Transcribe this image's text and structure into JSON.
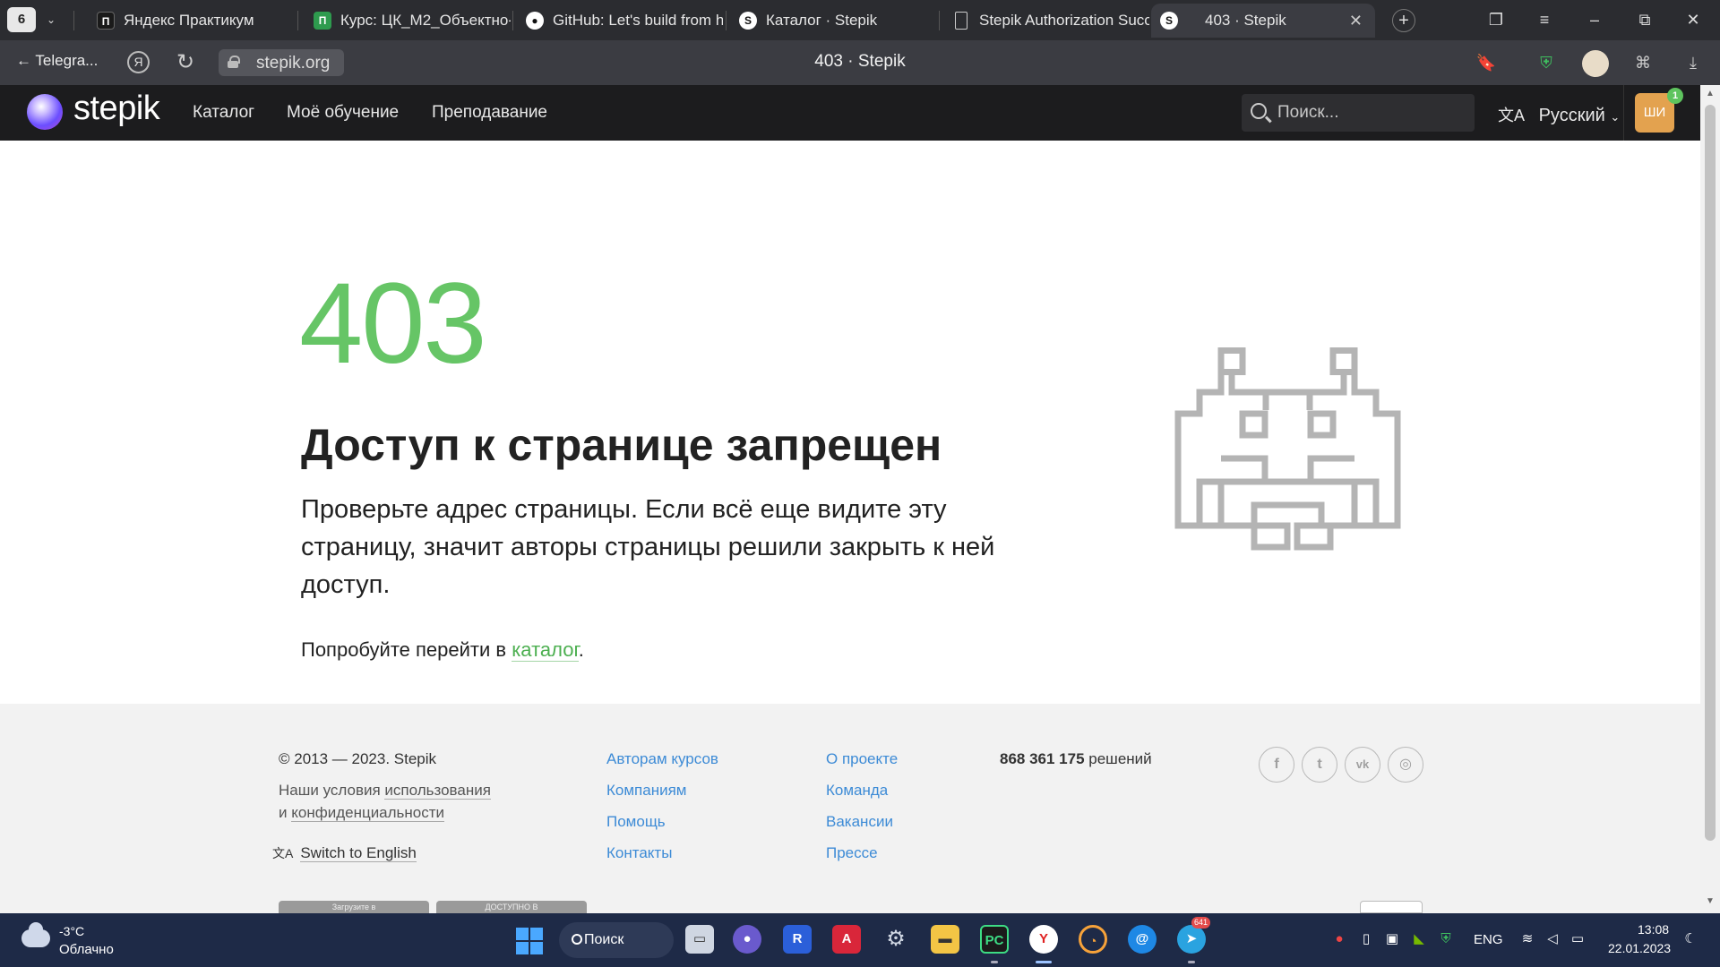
{
  "browser": {
    "tab_count": "6",
    "tabs": [
      {
        "title": "Яндекс Практикум",
        "icon": "yandex-practicum-icon"
      },
      {
        "title": "Курс: ЦК_М2_Объектно-",
        "icon": "course-icon"
      },
      {
        "title": "GitHub: Let's build from here",
        "icon": "github-icon"
      },
      {
        "title": "Каталог · Stepik",
        "icon": "stepik-icon"
      },
      {
        "title": "Stepik Authorization Success",
        "icon": "document-icon"
      },
      {
        "title": "403 · Stepik",
        "icon": "stepik-icon"
      }
    ],
    "back_label": "Telegra...",
    "url": "stepik.org",
    "page_title": "403 · Stepik"
  },
  "header": {
    "logo": "stepik",
    "nav": [
      "Каталог",
      "Моё обучение",
      "Преподавание"
    ],
    "search_placeholder": "Поиск...",
    "language": "Русский",
    "avatar_initials": "ШИ",
    "notification_count": "1"
  },
  "error": {
    "code": "403",
    "title": "Доступ к странице запрещен",
    "description": "Проверьте адрес страницы. Если всё еще видите эту страницу, значит авторы страницы решили закрыть к ней доступ.",
    "hint_prefix": "Попробуйте перейти в ",
    "hint_link": "каталог",
    "hint_suffix": "."
  },
  "footer": {
    "copyright": "© 2013 — 2023. Stepik",
    "terms_prefix": "Наши условия ",
    "terms_usage": "использования",
    "terms_and": "и ",
    "terms_privacy": "конфиденциальности",
    "switch_lang": "Switch to English",
    "col1": [
      "Авторам курсов",
      "Компаниям",
      "Помощь",
      "Контакты"
    ],
    "col2": [
      "О проекте",
      "Команда",
      "Вакансии",
      "Прессе"
    ],
    "solutions_count": "868 361 175",
    "solutions_label": " решений",
    "store_badges": [
      "Загрузите в",
      "ДОСТУПНО В"
    ]
  },
  "taskbar": {
    "weather_temp": "-3°C",
    "weather_condition": "Облачно",
    "search_label": "Поиск",
    "telegram_badge": "641",
    "language": "ENG",
    "time": "13:08",
    "date": "22.01.2023"
  },
  "colors": {
    "accent_green": "#66c566",
    "link_blue": "#3d8bd6",
    "header_bg": "#1c1c1e",
    "avatar_bg": "#e3a24f"
  }
}
